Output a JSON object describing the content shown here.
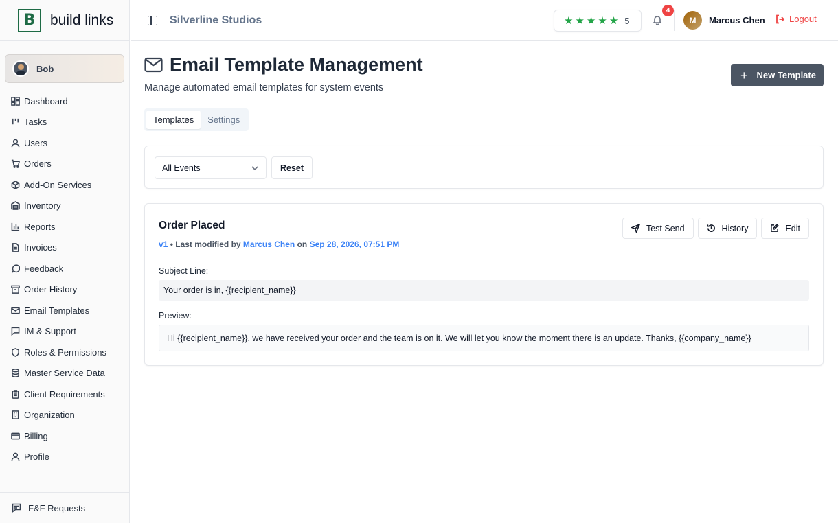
{
  "brand": {
    "logo_letter": "B",
    "name": "build links"
  },
  "current_user": {
    "name": "Bob"
  },
  "sidebar": {
    "items": [
      {
        "label": "Dashboard",
        "icon": "dashboard-icon"
      },
      {
        "label": "Tasks",
        "icon": "tasks-icon"
      },
      {
        "label": "Users",
        "icon": "user-icon"
      },
      {
        "label": "Orders",
        "icon": "cart-icon"
      },
      {
        "label": "Add-On Services",
        "icon": "package-icon"
      },
      {
        "label": "Inventory",
        "icon": "warehouse-icon"
      },
      {
        "label": "Reports",
        "icon": "bar-chart-icon"
      },
      {
        "label": "Invoices",
        "icon": "file-icon"
      },
      {
        "label": "Feedback",
        "icon": "message-circle-icon"
      },
      {
        "label": "Order History",
        "icon": "archive-icon"
      },
      {
        "label": "Email Templates",
        "icon": "mail-icon"
      },
      {
        "label": "IM & Support",
        "icon": "message-square-icon"
      },
      {
        "label": "Roles & Permissions",
        "icon": "shield-icon"
      },
      {
        "label": "Master Service Data",
        "icon": "database-icon"
      },
      {
        "label": "Client Requirements",
        "icon": "clipboard-icon"
      },
      {
        "label": "Organization",
        "icon": "building-icon"
      },
      {
        "label": "Billing",
        "icon": "credit-card-icon"
      },
      {
        "label": "Profile",
        "icon": "user-icon"
      }
    ],
    "footer_label": "F&F Requests"
  },
  "header": {
    "company": "Silverline Studios",
    "rating_value": "5",
    "rating_stars": 5,
    "notification_count": "4",
    "user_initial": "M",
    "user_name": "Marcus Chen",
    "logout_label": "Logout"
  },
  "page": {
    "title": "Email Template Management",
    "subtitle": "Manage automated email templates for system events",
    "new_button": "New Template",
    "tabs": [
      "Templates",
      "Settings"
    ],
    "active_tab": "Templates"
  },
  "filters": {
    "event_select": "All Events",
    "reset_label": "Reset"
  },
  "template": {
    "name": "Order Placed",
    "version": "v1",
    "meta_prefix": " • Last modified by ",
    "modified_by": "Marcus Chen",
    "meta_on": " on ",
    "modified_at": "Sep 28, 2026, 07:51 PM",
    "actions": {
      "test_send": "Test Send",
      "history": "History",
      "edit": "Edit"
    },
    "subject_label": "Subject Line:",
    "subject": "Your order is in, {{recipient_name}}",
    "preview_label": "Preview:",
    "preview": "Hi {{recipient_name}}, we have received your order and the team is on it. We will let you know the moment there is an update. Thanks, {{company_name}}"
  },
  "colors": {
    "brand_green": "#1e6b45",
    "primary_button": "#4b5563",
    "link_blue": "#3b82f6",
    "danger": "#ef4444",
    "star": "#22a447"
  }
}
